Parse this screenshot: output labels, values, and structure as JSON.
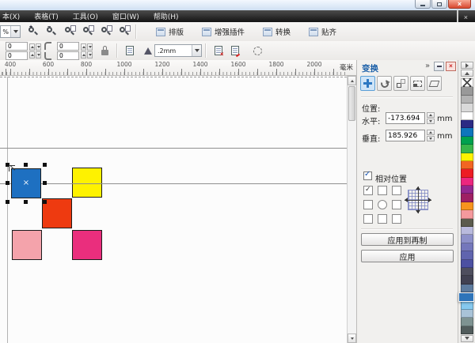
{
  "menu_bar": {
    "items": [
      "本(X)",
      "表格(T)",
      "工具(O)",
      "窗口(W)",
      "帮助(H)"
    ]
  },
  "toolbar": {
    "zoom_value": "%",
    "zoom_icons": [
      "zoom-in",
      "zoom-out",
      "zoom-selected",
      "zoom-all",
      "zoom-page",
      "zoom-width"
    ],
    "plugin_buttons": [
      "排版",
      "增强插件",
      "转换",
      "贴齐"
    ]
  },
  "property_bar": {
    "corner_radius": {
      "top_left": "0",
      "bottom_left": "0",
      "top_right": "0",
      "bottom_right": "0"
    },
    "outline_width": ".2mm"
  },
  "ruler": {
    "labels": [
      "400",
      "600",
      "800",
      "1000",
      "1200",
      "1400",
      "1600",
      "1800",
      "2000"
    ],
    "unit": "毫米"
  },
  "docker": {
    "title": "变换",
    "collapse_glyph": "»",
    "tools": [
      "position",
      "rotate",
      "scale-mirror",
      "size",
      "skew"
    ],
    "active_tool": "position",
    "position_section": {
      "label": "位置:",
      "horizontal_label": "水平:",
      "horizontal_value": "-173.694",
      "vertical_label": "垂直:",
      "vertical_value": "185.926",
      "unit": "mm"
    },
    "relative_position": {
      "label": "相对位置",
      "checked": true
    },
    "anchor_grid": {
      "checked_cell": "top-left",
      "center_style": "radio"
    },
    "buttons": {
      "apply_to_duplicate": "应用到再制",
      "apply": "应用"
    }
  },
  "canvas": {
    "squares": [
      {
        "id": "blue",
        "color": "#1e70c1",
        "selected": true
      },
      {
        "id": "yellow",
        "color": "#fef200",
        "selected": false
      },
      {
        "id": "red",
        "color": "#ee3a10",
        "selected": false
      },
      {
        "id": "pink",
        "color": "#f4a3ab",
        "selected": false
      },
      {
        "id": "magenta",
        "color": "#ea2e7d",
        "selected": false
      }
    ]
  },
  "palette": {
    "selected_index": 26,
    "colors": [
      "none",
      "#999999",
      "#b3b3b3",
      "#d9d9d9",
      "#ffffff",
      "#2b2a84",
      "#0e76bc",
      "#00a14e",
      "#39b54a",
      "#fff200",
      "#f26522",
      "#ed1c24",
      "#ec267f",
      "#93278f",
      "#9e1f63",
      "#f7941d",
      "#f5999d",
      "#5b5b4d",
      "#b9badd",
      "#8d90c9",
      "#7477bb",
      "#6064ae",
      "#4c50a2",
      "#4e4e5e",
      "#414152",
      "#5d7b9e",
      "#2e74b9",
      "#86c9ef",
      "#a9c3d8",
      "#7e9392",
      "#515c5c"
    ]
  }
}
